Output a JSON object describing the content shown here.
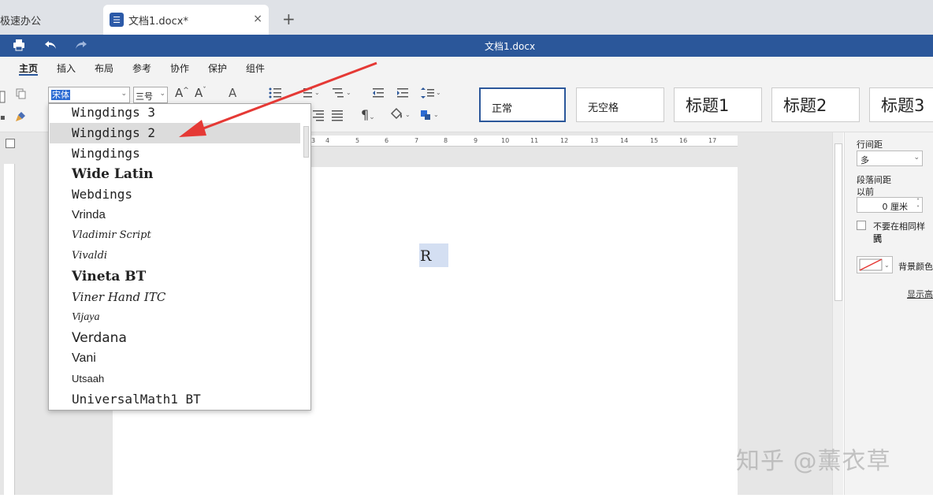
{
  "tabs": {
    "app_tab": "极速办公",
    "doc_tab": "文档1.docx*",
    "close_glyph": "×",
    "add_glyph": "+"
  },
  "titlebar": {
    "doc_title": "文档1.docx"
  },
  "menu": {
    "items": [
      "主页",
      "插入",
      "布局",
      "参考",
      "协作",
      "保护",
      "组件"
    ],
    "active": "主页"
  },
  "ribbon": {
    "font_name": "宋体",
    "font_size": "三号",
    "styles": [
      "正常",
      "无空格",
      "标题1",
      "标题2",
      "标题3"
    ],
    "selected_style": "正常"
  },
  "font_dropdown": {
    "items": [
      {
        "label": "Wingdings 3",
        "font": "DejaVu Sans Mono",
        "size": 16,
        "weight": "normal",
        "style": "normal"
      },
      {
        "label": "Wingdings 2",
        "font": "DejaVu Sans Mono",
        "size": 16,
        "weight": "normal",
        "style": "normal",
        "highlighted": true
      },
      {
        "label": "Wingdings",
        "font": "DejaVu Sans Mono",
        "size": 16,
        "weight": "normal",
        "style": "normal"
      },
      {
        "label": "Wide Latin",
        "font": "DejaVu Serif",
        "size": 17,
        "weight": "bold",
        "style": "normal"
      },
      {
        "label": "Webdings",
        "font": "DejaVu Sans Mono",
        "size": 16,
        "weight": "normal",
        "style": "normal"
      },
      {
        "label": "Vrinda",
        "font": "Liberation Sans",
        "size": 15,
        "weight": "normal",
        "style": "normal"
      },
      {
        "label": "Vladimir Script",
        "font": "DejaVu Serif",
        "size": 13,
        "weight": "normal",
        "style": "italic"
      },
      {
        "label": "Vivaldi",
        "font": "DejaVu Serif",
        "size": 13,
        "weight": "normal",
        "style": "italic"
      },
      {
        "label": "Vineta BT",
        "font": "DejaVu Serif",
        "size": 17,
        "weight": "bold",
        "style": "normal"
      },
      {
        "label": "Viner Hand ITC",
        "font": "DejaVu Serif",
        "size": 15,
        "weight": "normal",
        "style": "italic"
      },
      {
        "label": "Vijaya",
        "font": "Liberation Serif",
        "size": 14,
        "weight": "normal",
        "style": "italic"
      },
      {
        "label": "Verdana",
        "font": "DejaVu Sans",
        "size": 17,
        "weight": "normal",
        "style": "normal"
      },
      {
        "label": "Vani",
        "font": "Liberation Sans",
        "size": 16,
        "weight": "normal",
        "style": "normal"
      },
      {
        "label": "Utsaah",
        "font": "Liberation Sans",
        "size": 13,
        "weight": "normal",
        "style": "normal"
      },
      {
        "label": "UniversalMath1 BT",
        "font": "DejaVu Sans Mono",
        "size": 16,
        "weight": "normal",
        "style": "normal"
      }
    ]
  },
  "ruler": {
    "ticks": [
      "3",
      "4",
      "5",
      "6",
      "7",
      "8",
      "9",
      "10",
      "11",
      "12",
      "13",
      "14",
      "15",
      "16",
      "17"
    ]
  },
  "document": {
    "selected_text": "R"
  },
  "side_panel": {
    "line_spacing_label": "行间距",
    "line_spacing_value": "多",
    "para_spacing_label": "段落间距",
    "before_label": "以前",
    "before_value": "0 厘米",
    "checkbox_label": "不要在相同样式",
    "checkbox_label_2": "隔",
    "bg_color_label": "背景颜色",
    "show_more": "显示高"
  },
  "watermark": "知乎 @薰衣草",
  "colors": {
    "titlebar": "#2b579a",
    "arrow": "#e53935",
    "selection": "#2b6bd3"
  }
}
